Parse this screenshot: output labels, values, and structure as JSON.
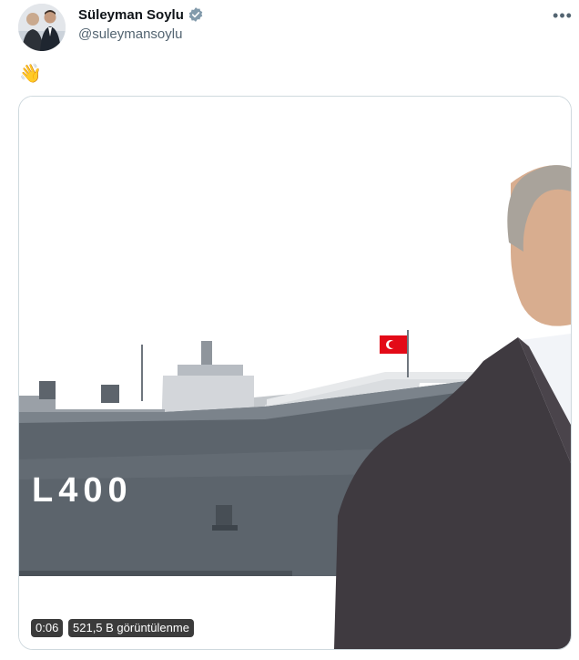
{
  "author": {
    "name": "Süleyman Soylu",
    "handle": "@suleymansoylu",
    "verified_icon": "verified-badge-icon",
    "verified_color": "#829aab"
  },
  "menu": {
    "icon": "more-dots-icon",
    "glyph": "•••"
  },
  "post": {
    "text": "👋"
  },
  "video": {
    "time": "0:06",
    "views": "521,5 B görüntülenme",
    "ship_hull_number": "L400"
  },
  "colors": {
    "text": "#0f1419",
    "secondary": "#536471",
    "border": "#cfd9de",
    "flag": "#e30a17"
  }
}
